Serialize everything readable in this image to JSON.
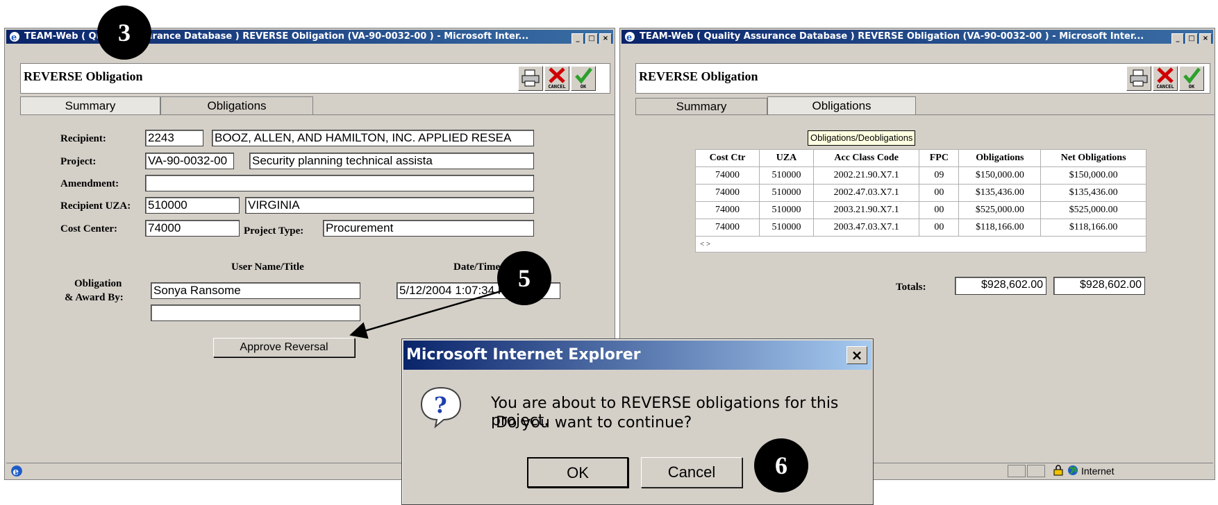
{
  "left_window": {
    "title": "TEAM-Web ( Quality Assurance Database ) REVERSE Obligation (VA-90-0032-00 ) - Microsoft Inter...",
    "header_title": "REVERSE Obligation",
    "toolbar": {
      "print_icon": "printer-icon",
      "cancel_label": "CANCEL",
      "ok_label": "OK"
    },
    "tabs": [
      "Summary",
      "Obligations"
    ],
    "form": {
      "recipient_label": "Recipient:",
      "recipient_id": "2243",
      "recipient_name": "BOOZ, ALLEN, AND HAMILTON, INC. APPLIED RESEA",
      "project_label": "Project:",
      "project_id": "VA-90-0032-00",
      "project_desc": "Security planning technical assista",
      "amendment_label": "Amendment:",
      "amendment_value": "",
      "uza_label": "Recipient UZA:",
      "uza_code": "510000",
      "uza_name": "VIRGINIA",
      "cost_center_label": "Cost Center:",
      "cost_center_value": "74000",
      "project_type_label": "Project Type:",
      "project_type_value": "Procurement",
      "user_name_header": "User Name/Title",
      "date_time_header": "Date/Time",
      "obligation_label_1": "Obligation",
      "obligation_label_2": "& Award By:",
      "user_name_value": "Sonya  Ransome",
      "user_title_value": "",
      "date_time_value": "5/12/2004 1:07:34 PM",
      "approve_button": "Approve Reversal"
    }
  },
  "right_window": {
    "title": "TEAM-Web ( Quality Assurance Database ) REVERSE Obligation (VA-90-0032-00 ) - Microsoft Inter...",
    "header_title": "REVERSE Obligation",
    "toolbar": {
      "print_icon": "printer-icon",
      "cancel_label": "CANCEL",
      "ok_label": "OK"
    },
    "tabs": [
      "Summary",
      "Obligations"
    ],
    "table_caption": "Obligations/Deobligations",
    "columns": [
      "Cost Ctr",
      "UZA",
      "Acc Class Code",
      "FPC",
      "Obligations",
      "Net Obligations"
    ],
    "rows": [
      [
        "74000",
        "510000",
        "2002.21.90.X7.1",
        "09",
        "$150,000.00",
        "$150,000.00"
      ],
      [
        "74000",
        "510000",
        "2002.47.03.X7.1",
        "00",
        "$135,436.00",
        "$135,436.00"
      ],
      [
        "74000",
        "510000",
        "2003.21.90.X7.1",
        "00",
        "$525,000.00",
        "$525,000.00"
      ],
      [
        "74000",
        "510000",
        "2003.47.03.X7.1",
        "00",
        "$118,166.00",
        "$118,166.00"
      ]
    ],
    "pager": "< >",
    "totals_label": "Totals:",
    "total_obligations": "$928,602.00",
    "total_net": "$928,602.00",
    "status_zone": "Internet"
  },
  "dialog": {
    "title": "Microsoft Internet Explorer",
    "message_line1": "You are about to REVERSE obligations for this project.",
    "message_line2": " Do you want to continue?",
    "ok_label": "OK",
    "cancel_label": "Cancel"
  },
  "markers": {
    "m3": "3",
    "m5": "5",
    "m6": "6"
  }
}
